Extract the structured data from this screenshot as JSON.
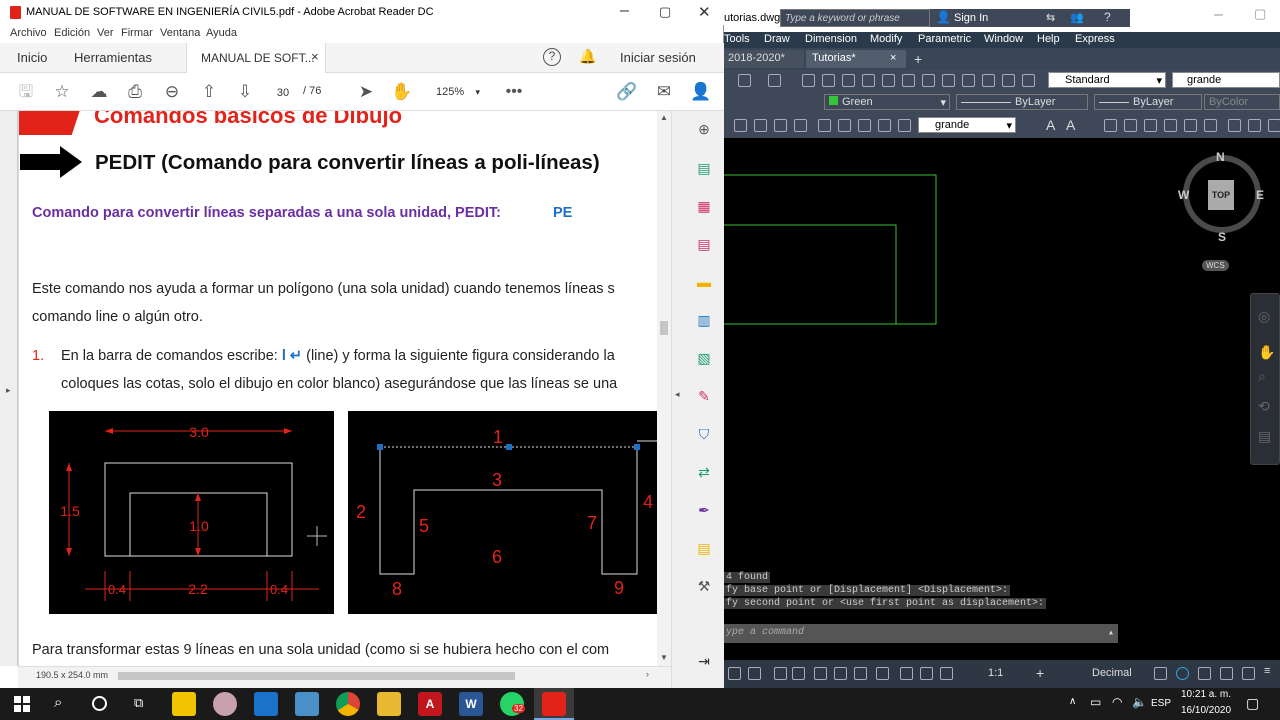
{
  "acrobat": {
    "window_title": "MANUAL DE SOFTWARE EN INGENIERÍA CIVIL5.pdf - Adobe Acrobat Reader DC",
    "menu": [
      "Archivo",
      "Edición",
      "Ver",
      "Firmar",
      "Ventana",
      "Ayuda"
    ],
    "tabs": {
      "home": "Inicio",
      "tools": "Herramientas",
      "doc": "MANUAL DE SOFT..."
    },
    "sign_in": "Iniciar sesión",
    "page_current": "30",
    "page_total": "/  76",
    "zoom": "125%",
    "page_size": "190.5 x 254.0 mm",
    "doc": {
      "heading_top": "Comandos básicos de Dibujo",
      "heading": "PEDIT (Comando para convertir líneas a poli-líneas)",
      "subtitle": "Comando para convertir líneas separadas a una sola unidad, PEDIT:",
      "subtitle_cmd": "PE",
      "para1_line1": "Este comando nos ayuda a formar un polígono (una sola unidad) cuando tenemos líneas s",
      "para1_line2": "comando line o algún otro.",
      "list_num": "1.",
      "item_line1_a": "En la barra de comandos escribe:",
      "item_cmd": "l ↵",
      "item_line1_b": "(line) y forma la siguiente figura considerando la",
      "item_line2": "coloques las cotas, solo el dibujo en color blanco) asegurándose que las líneas se una",
      "para2": "Para transformar estas 9 líneas en una sola unidad (como si se hubiera hecho con el com",
      "fig1": {
        "dim_top": "3.0",
        "dim_left": "1.5",
        "dim_center": "1.0",
        "dim_b1": "0.4",
        "dim_b2": "2.2",
        "dim_b3": "0.4"
      },
      "fig2": {
        "n1": "1",
        "n2": "2",
        "n3": "3",
        "n4": "4",
        "n5": "5",
        "n6": "6",
        "n7": "7",
        "n8": "8",
        "n9": "9"
      }
    }
  },
  "autocad": {
    "title_file": "utorias.dwg",
    "search_placeholder": "Type a keyword or phrase",
    "sign_in": "Sign In",
    "ribbon_tabs": [
      "Tools",
      "Draw",
      "Dimension",
      "Modify",
      "Parametric",
      "Window",
      "Help",
      "Express"
    ],
    "doc_tabs": [
      "2018-2020*",
      "Tutorias*"
    ],
    "style_text": "Standard",
    "style_dim": "grande",
    "color": "Green",
    "linetype": "ByLayer",
    "lineweight": "ByLayer",
    "plotstyle": "ByColor",
    "multileader": "grande",
    "viewcube": {
      "n": "N",
      "s": "S",
      "e": "E",
      "w": "W",
      "top": "TOP",
      "wcs": "WCS"
    },
    "msg1": "4 found",
    "msg2": "fy base point or [Displacement] <Displacement>:",
    "msg3": "fy second point or <use first point as displacement>:",
    "cmd_placeholder": "ype a command",
    "status_scale": "1:1",
    "status_units": "Decimal"
  },
  "taskbar": {
    "time": "10:21 a. m.",
    "date": "16/10/2020",
    "lang": "ESP",
    "badge": "32"
  },
  "colors": {
    "acro_red": "#e2231a",
    "cad_green": "#35c535",
    "purple": "#6b2fa0",
    "blue": "#1f6fc5"
  }
}
